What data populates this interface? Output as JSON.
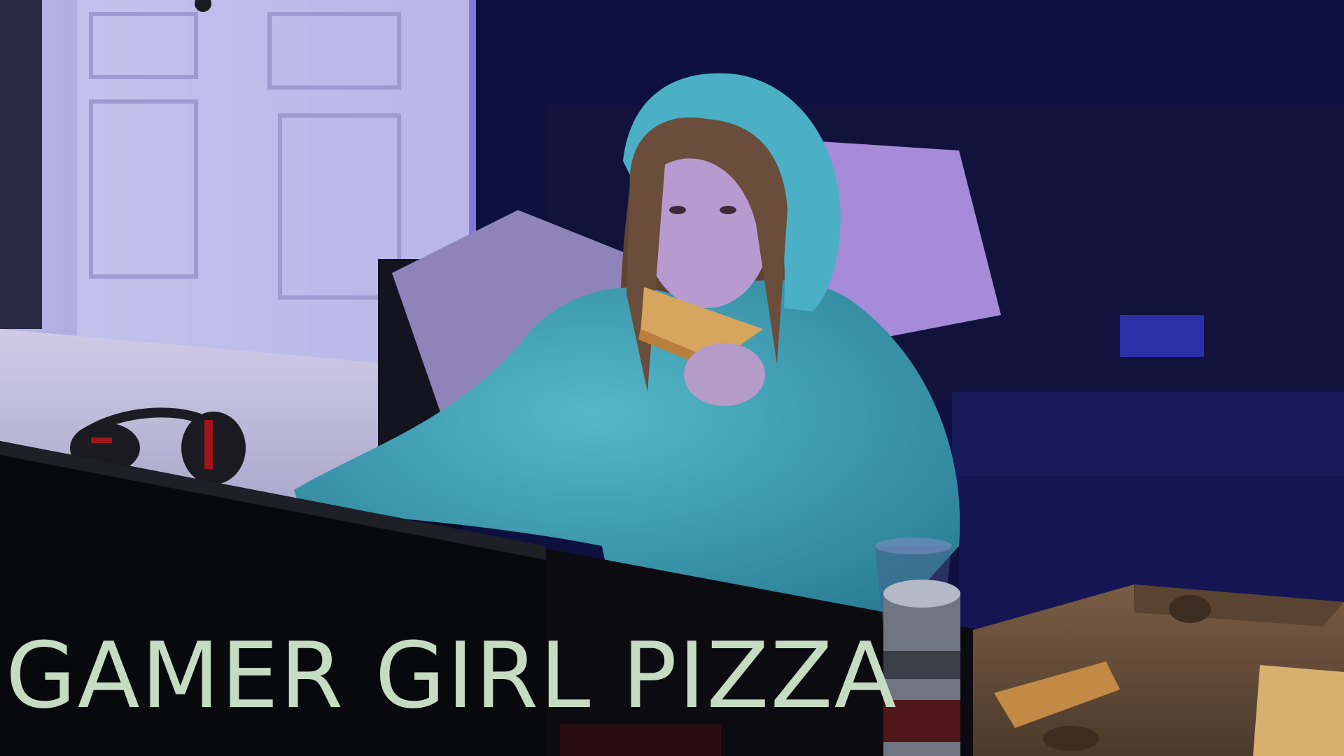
{
  "caption": {
    "text": "GAMER GIRL PIZZA",
    "color": "#c5dcc2"
  },
  "scene": {
    "subject": "girl-in-blue-hoodie-eating-pizza",
    "palette": {
      "room_wall": "#0d0f3a",
      "door": "#c9c6f0",
      "hoodie": "#3b9fb4",
      "hair": "#6b4d3b",
      "skin": "#b79bd0",
      "pizza": "#d8a55e",
      "desk": "#0c0c10",
      "monitor": "#08090c",
      "pizza_box": "#6e5340",
      "headphones": "#a0141c",
      "can": "#9aa0ab",
      "sofa": "#111236",
      "pillow": "#a58bd8"
    }
  }
}
